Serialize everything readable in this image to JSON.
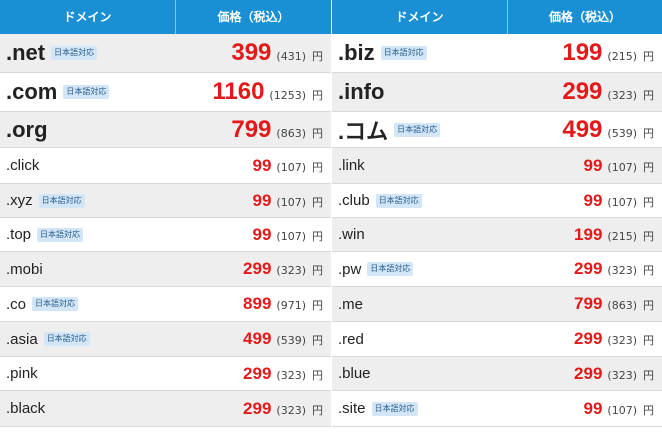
{
  "columns": [
    {
      "header_domain": "ドメイン",
      "header_price": "価格（税込）",
      "rows": [
        {
          "domain": ".net",
          "badge": "日本語対応",
          "price": "399",
          "tax": "(431)",
          "yen": "円"
        },
        {
          "domain": ".com",
          "badge": "日本語対応",
          "price": "1160",
          "tax": "(1253)",
          "yen": "円"
        },
        {
          "domain": ".org",
          "badge": "",
          "price": "799",
          "tax": "(863)",
          "yen": "円"
        },
        {
          "domain": ".click",
          "badge": "",
          "price": "99",
          "tax": "(107)",
          "yen": "円"
        },
        {
          "domain": ".xyz",
          "badge": "日本語対応",
          "price": "99",
          "tax": "(107)",
          "yen": "円"
        },
        {
          "domain": ".top",
          "badge": "日本語対応",
          "price": "99",
          "tax": "(107)",
          "yen": "円"
        },
        {
          "domain": ".mobi",
          "badge": "",
          "price": "299",
          "tax": "(323)",
          "yen": "円"
        },
        {
          "domain": ".co",
          "badge": "日本語対応",
          "price": "899",
          "tax": "(971)",
          "yen": "円"
        },
        {
          "domain": ".asia",
          "badge": "日本語対応",
          "price": "499",
          "tax": "(539)",
          "yen": "円"
        },
        {
          "domain": ".pink",
          "badge": "",
          "price": "299",
          "tax": "(323)",
          "yen": "円"
        },
        {
          "domain": ".black",
          "badge": "",
          "price": "299",
          "tax": "(323)",
          "yen": "円"
        }
      ]
    },
    {
      "header_domain": "ドメイン",
      "header_price": "価格（税込）",
      "rows": [
        {
          "domain": ".biz",
          "badge": "日本語対応",
          "price": "199",
          "tax": "(215)",
          "yen": "円"
        },
        {
          "domain": ".info",
          "badge": "",
          "price": "299",
          "tax": "(323)",
          "yen": "円"
        },
        {
          "domain": ".コム",
          "badge": "日本語対応",
          "price": "499",
          "tax": "(539)",
          "yen": "円"
        },
        {
          "domain": ".link",
          "badge": "",
          "price": "99",
          "tax": "(107)",
          "yen": "円"
        },
        {
          "domain": ".club",
          "badge": "日本語対応",
          "price": "99",
          "tax": "(107)",
          "yen": "円"
        },
        {
          "domain": ".win",
          "badge": "",
          "price": "199",
          "tax": "(215)",
          "yen": "円"
        },
        {
          "domain": ".pw",
          "badge": "日本語対応",
          "price": "299",
          "tax": "(323)",
          "yen": "円"
        },
        {
          "domain": ".me",
          "badge": "",
          "price": "799",
          "tax": "(863)",
          "yen": "円"
        },
        {
          "domain": ".red",
          "badge": "",
          "price": "299",
          "tax": "(323)",
          "yen": "円"
        },
        {
          "domain": ".blue",
          "badge": "",
          "price": "299",
          "tax": "(323)",
          "yen": "円"
        },
        {
          "domain": ".site",
          "badge": "日本語対応",
          "price": "99",
          "tax": "(107)",
          "yen": "円"
        }
      ]
    }
  ]
}
